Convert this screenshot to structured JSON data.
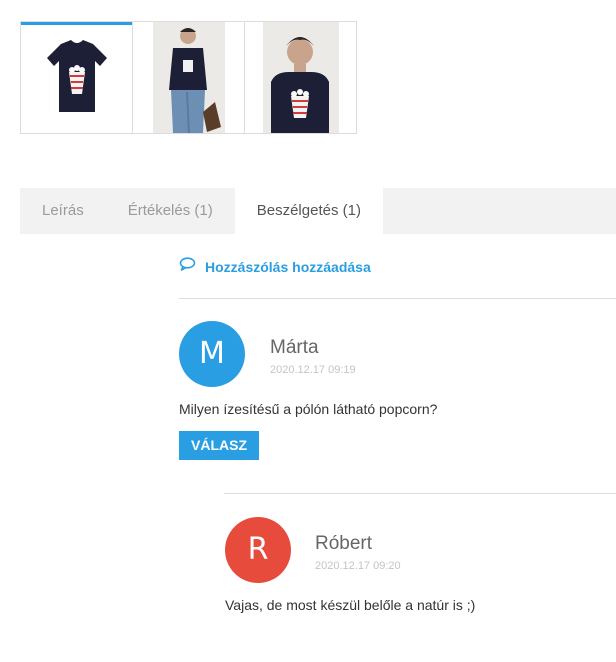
{
  "colors": {
    "accent": "#2a9ee2",
    "avatar_marta": "#2a9ee2",
    "avatar_robert": "#e74b3c",
    "reply_button": "#2a9ee2"
  },
  "gallery": {
    "thumbnails": [
      {
        "alt": "T-shirt product photo",
        "active": true
      },
      {
        "alt": "Model wearing T-shirt (full body)",
        "active": false
      },
      {
        "alt": "Model wearing T-shirt (front)",
        "active": false
      }
    ]
  },
  "tabs": [
    {
      "label": "Leírás",
      "active": false
    },
    {
      "label": "Értékelés (1)",
      "active": false
    },
    {
      "label": "Beszélgetés (1)",
      "active": true
    }
  ],
  "discussion": {
    "add_comment_label": "Hozzászólás hozzáadása",
    "add_comment_icon": "speech-bubble-icon",
    "comments": [
      {
        "initial": "M",
        "author": "Márta",
        "date": "2020.12.17 09:19",
        "text": "Milyen ízesítésű a pólón látható popcorn?",
        "reply_label": "VÁLASZ"
      }
    ],
    "replies": [
      {
        "initial": "R",
        "author": "Róbert",
        "date": "2020.12.17 09:20",
        "text": "Vajas, de most készül belőle a natúr is ;)"
      }
    ]
  }
}
